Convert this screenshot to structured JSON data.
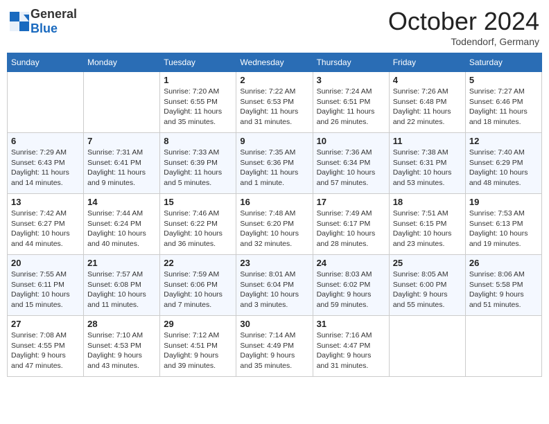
{
  "header": {
    "logo_general": "General",
    "logo_blue": "Blue",
    "month_title": "October 2024",
    "location": "Todendorf, Germany"
  },
  "weekdays": [
    "Sunday",
    "Monday",
    "Tuesday",
    "Wednesday",
    "Thursday",
    "Friday",
    "Saturday"
  ],
  "weeks": [
    [
      {
        "day": "",
        "sunrise": "",
        "sunset": "",
        "daylight": ""
      },
      {
        "day": "",
        "sunrise": "",
        "sunset": "",
        "daylight": ""
      },
      {
        "day": "1",
        "sunrise": "Sunrise: 7:20 AM",
        "sunset": "Sunset: 6:55 PM",
        "daylight": "Daylight: 11 hours and 35 minutes."
      },
      {
        "day": "2",
        "sunrise": "Sunrise: 7:22 AM",
        "sunset": "Sunset: 6:53 PM",
        "daylight": "Daylight: 11 hours and 31 minutes."
      },
      {
        "day": "3",
        "sunrise": "Sunrise: 7:24 AM",
        "sunset": "Sunset: 6:51 PM",
        "daylight": "Daylight: 11 hours and 26 minutes."
      },
      {
        "day": "4",
        "sunrise": "Sunrise: 7:26 AM",
        "sunset": "Sunset: 6:48 PM",
        "daylight": "Daylight: 11 hours and 22 minutes."
      },
      {
        "day": "5",
        "sunrise": "Sunrise: 7:27 AM",
        "sunset": "Sunset: 6:46 PM",
        "daylight": "Daylight: 11 hours and 18 minutes."
      }
    ],
    [
      {
        "day": "6",
        "sunrise": "Sunrise: 7:29 AM",
        "sunset": "Sunset: 6:43 PM",
        "daylight": "Daylight: 11 hours and 14 minutes."
      },
      {
        "day": "7",
        "sunrise": "Sunrise: 7:31 AM",
        "sunset": "Sunset: 6:41 PM",
        "daylight": "Daylight: 11 hours and 9 minutes."
      },
      {
        "day": "8",
        "sunrise": "Sunrise: 7:33 AM",
        "sunset": "Sunset: 6:39 PM",
        "daylight": "Daylight: 11 hours and 5 minutes."
      },
      {
        "day": "9",
        "sunrise": "Sunrise: 7:35 AM",
        "sunset": "Sunset: 6:36 PM",
        "daylight": "Daylight: 11 hours and 1 minute."
      },
      {
        "day": "10",
        "sunrise": "Sunrise: 7:36 AM",
        "sunset": "Sunset: 6:34 PM",
        "daylight": "Daylight: 10 hours and 57 minutes."
      },
      {
        "day": "11",
        "sunrise": "Sunrise: 7:38 AM",
        "sunset": "Sunset: 6:31 PM",
        "daylight": "Daylight: 10 hours and 53 minutes."
      },
      {
        "day": "12",
        "sunrise": "Sunrise: 7:40 AM",
        "sunset": "Sunset: 6:29 PM",
        "daylight": "Daylight: 10 hours and 48 minutes."
      }
    ],
    [
      {
        "day": "13",
        "sunrise": "Sunrise: 7:42 AM",
        "sunset": "Sunset: 6:27 PM",
        "daylight": "Daylight: 10 hours and 44 minutes."
      },
      {
        "day": "14",
        "sunrise": "Sunrise: 7:44 AM",
        "sunset": "Sunset: 6:24 PM",
        "daylight": "Daylight: 10 hours and 40 minutes."
      },
      {
        "day": "15",
        "sunrise": "Sunrise: 7:46 AM",
        "sunset": "Sunset: 6:22 PM",
        "daylight": "Daylight: 10 hours and 36 minutes."
      },
      {
        "day": "16",
        "sunrise": "Sunrise: 7:48 AM",
        "sunset": "Sunset: 6:20 PM",
        "daylight": "Daylight: 10 hours and 32 minutes."
      },
      {
        "day": "17",
        "sunrise": "Sunrise: 7:49 AM",
        "sunset": "Sunset: 6:17 PM",
        "daylight": "Daylight: 10 hours and 28 minutes."
      },
      {
        "day": "18",
        "sunrise": "Sunrise: 7:51 AM",
        "sunset": "Sunset: 6:15 PM",
        "daylight": "Daylight: 10 hours and 23 minutes."
      },
      {
        "day": "19",
        "sunrise": "Sunrise: 7:53 AM",
        "sunset": "Sunset: 6:13 PM",
        "daylight": "Daylight: 10 hours and 19 minutes."
      }
    ],
    [
      {
        "day": "20",
        "sunrise": "Sunrise: 7:55 AM",
        "sunset": "Sunset: 6:11 PM",
        "daylight": "Daylight: 10 hours and 15 minutes."
      },
      {
        "day": "21",
        "sunrise": "Sunrise: 7:57 AM",
        "sunset": "Sunset: 6:08 PM",
        "daylight": "Daylight: 10 hours and 11 minutes."
      },
      {
        "day": "22",
        "sunrise": "Sunrise: 7:59 AM",
        "sunset": "Sunset: 6:06 PM",
        "daylight": "Daylight: 10 hours and 7 minutes."
      },
      {
        "day": "23",
        "sunrise": "Sunrise: 8:01 AM",
        "sunset": "Sunset: 6:04 PM",
        "daylight": "Daylight: 10 hours and 3 minutes."
      },
      {
        "day": "24",
        "sunrise": "Sunrise: 8:03 AM",
        "sunset": "Sunset: 6:02 PM",
        "daylight": "Daylight: 9 hours and 59 minutes."
      },
      {
        "day": "25",
        "sunrise": "Sunrise: 8:05 AM",
        "sunset": "Sunset: 6:00 PM",
        "daylight": "Daylight: 9 hours and 55 minutes."
      },
      {
        "day": "26",
        "sunrise": "Sunrise: 8:06 AM",
        "sunset": "Sunset: 5:58 PM",
        "daylight": "Daylight: 9 hours and 51 minutes."
      }
    ],
    [
      {
        "day": "27",
        "sunrise": "Sunrise: 7:08 AM",
        "sunset": "Sunset: 4:55 PM",
        "daylight": "Daylight: 9 hours and 47 minutes."
      },
      {
        "day": "28",
        "sunrise": "Sunrise: 7:10 AM",
        "sunset": "Sunset: 4:53 PM",
        "daylight": "Daylight: 9 hours and 43 minutes."
      },
      {
        "day": "29",
        "sunrise": "Sunrise: 7:12 AM",
        "sunset": "Sunset: 4:51 PM",
        "daylight": "Daylight: 9 hours and 39 minutes."
      },
      {
        "day": "30",
        "sunrise": "Sunrise: 7:14 AM",
        "sunset": "Sunset: 4:49 PM",
        "daylight": "Daylight: 9 hours and 35 minutes."
      },
      {
        "day": "31",
        "sunrise": "Sunrise: 7:16 AM",
        "sunset": "Sunset: 4:47 PM",
        "daylight": "Daylight: 9 hours and 31 minutes."
      },
      {
        "day": "",
        "sunrise": "",
        "sunset": "",
        "daylight": ""
      },
      {
        "day": "",
        "sunrise": "",
        "sunset": "",
        "daylight": ""
      }
    ]
  ]
}
